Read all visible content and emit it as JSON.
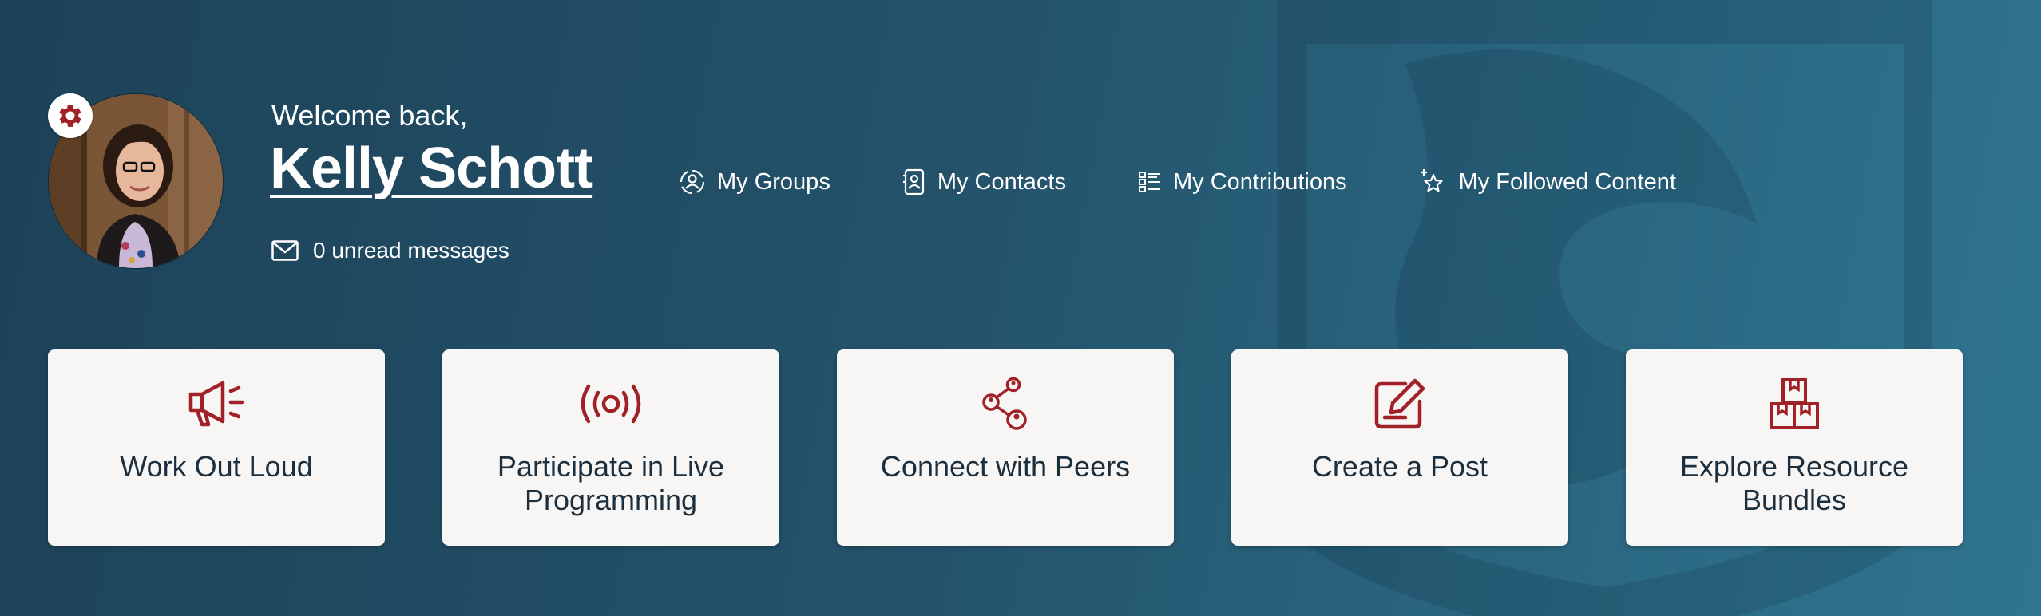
{
  "header": {
    "welcome_text": "Welcome back,",
    "user_name": "Kelly Schott",
    "unread_messages": "0 unread messages"
  },
  "quick_links": [
    {
      "label": "My Groups",
      "icon": "groups-icon"
    },
    {
      "label": "My Contacts",
      "icon": "contacts-icon"
    },
    {
      "label": "My Contributions",
      "icon": "contributions-icon"
    },
    {
      "label": "My Followed Content",
      "icon": "followed-star-icon"
    }
  ],
  "cards": [
    {
      "label": "Work Out Loud",
      "icon": "megaphone-icon"
    },
    {
      "label": "Participate in Live Programming",
      "icon": "broadcast-icon"
    },
    {
      "label": "Connect with Peers",
      "icon": "network-icon"
    },
    {
      "label": "Create a Post",
      "icon": "edit-post-icon"
    },
    {
      "label": "Explore Resource Bundles",
      "icon": "boxes-icon"
    }
  ],
  "colors": {
    "accent": "#a02127",
    "card_bg": "#f8f6f5",
    "card_text": "#1c2f3e",
    "bg_start": "#1d4258",
    "bg_end": "#2f7590"
  }
}
